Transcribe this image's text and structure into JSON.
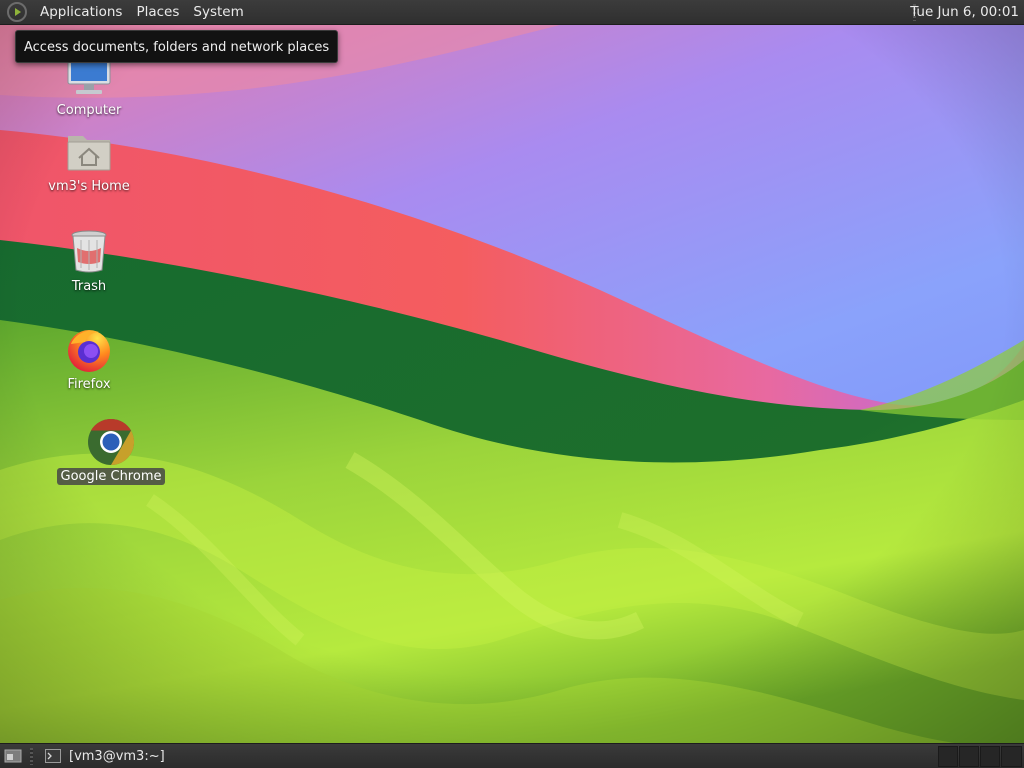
{
  "top_panel": {
    "menus": [
      "Applications",
      "Places",
      "System"
    ],
    "clock": "Tue Jun  6, 00:01"
  },
  "tooltip": {
    "text": "Access documents, folders and network places"
  },
  "desktop_icons": [
    {
      "label": "Computer",
      "icon": "computer-icon"
    },
    {
      "label": "vm3's Home",
      "icon": "home-folder-icon"
    },
    {
      "label": "Trash",
      "icon": "trash-icon"
    },
    {
      "label": "Firefox",
      "icon": "firefox-icon"
    },
    {
      "label": "Google Chrome",
      "icon": "chrome-icon",
      "selected": true
    }
  ],
  "bottom_panel": {
    "tasks": [
      {
        "label": "[vm3@vm3:~]",
        "icon": "terminal-icon"
      }
    ],
    "workspaces": 4
  },
  "colors": {
    "panel": "#2f2f2f",
    "accent_green": "#8fb33a",
    "tooltip_bg": "#121212"
  }
}
